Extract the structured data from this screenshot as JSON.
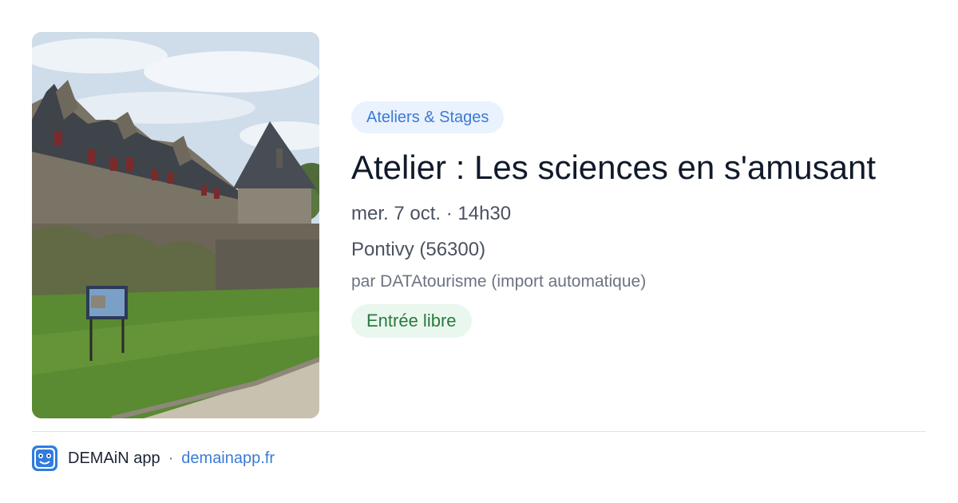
{
  "event": {
    "category": "Ateliers & Stages",
    "title": "Atelier : Les sciences en s'amusant",
    "datetime": "mer. 7 oct. · 14h30",
    "location": "Pontivy (56300)",
    "organizer": "par DATAtourisme (import automatique)",
    "price": "Entrée libre"
  },
  "footer": {
    "app_name": "DEMAiN app",
    "separator": "·",
    "website": "demainapp.fr"
  },
  "icons": {
    "app_logo": "demain-app-logo-icon"
  },
  "colors": {
    "accent_blue": "#3a7bd5",
    "category_bg": "#eaf2fd",
    "price_bg": "#eaf7ee",
    "price_text": "#2a7a3e",
    "title_text": "#111a2b"
  }
}
